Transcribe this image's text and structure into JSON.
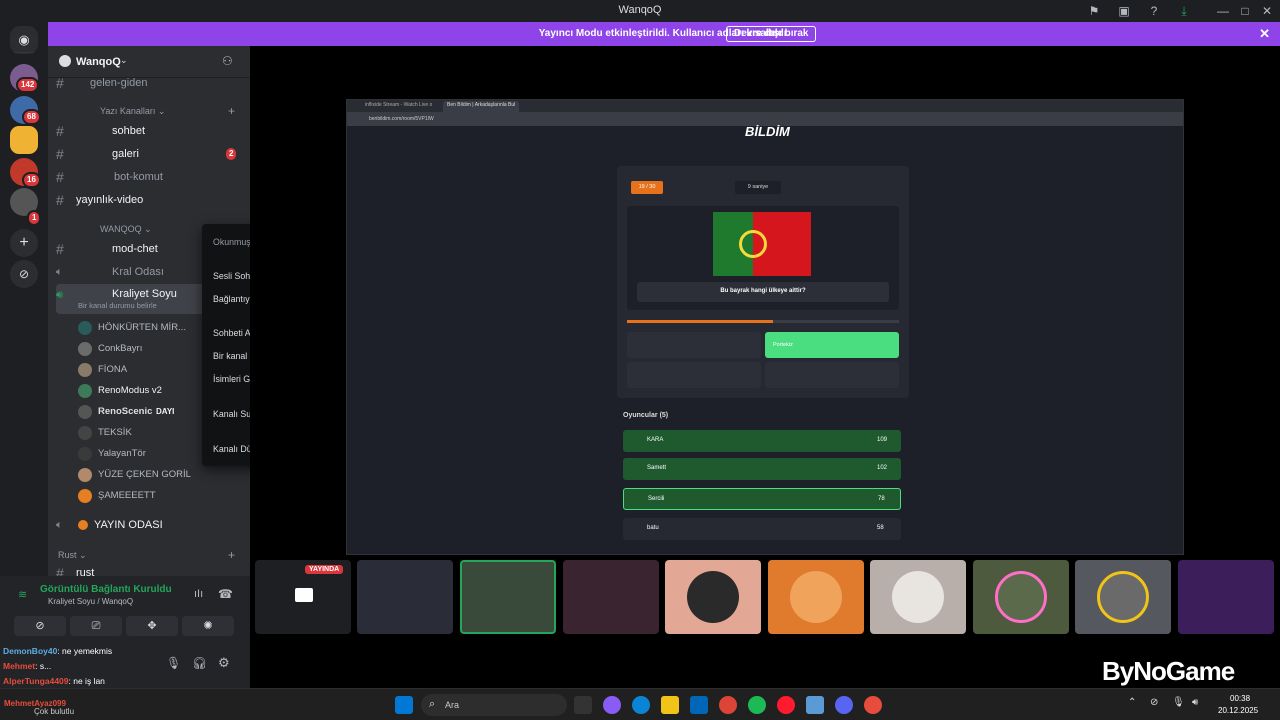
{
  "window": {
    "title": "WanqoQ"
  },
  "banner": {
    "message": "Yayıncı Modu etkinleştirildi. Kullanıcı adları kısaltıldı.",
    "button": "Devre dışı bırak"
  },
  "servers": {
    "badges": [
      "142",
      "68",
      "16",
      "1"
    ]
  },
  "guild": {
    "name": "WanqoQ"
  },
  "channels": {
    "top": [
      {
        "label": "gelen-giden"
      }
    ],
    "category1": "Yazı Kanalları",
    "text": [
      {
        "label": "sohbet"
      },
      {
        "label": "galeri",
        "badge": "2"
      },
      {
        "label": "bot-komut"
      },
      {
        "label": "yayınlık-video"
      }
    ],
    "category2": "WANQOQ",
    "wanqoq": [
      {
        "label": "mod-chet"
      },
      {
        "label": "Kral Odası"
      },
      {
        "label": "Kraliyet Soyu"
      }
    ],
    "channel_status": "Bir kanal durumu belirle",
    "members": [
      {
        "name": "HÖNKÜRTEN MİR..."
      },
      {
        "name": "ConkBayrı"
      },
      {
        "name": "FİONA"
      },
      {
        "name": "RenoModus v2"
      },
      {
        "name": "RenoScenic",
        "tag": "DAYI"
      },
      {
        "name": "TEKSİK"
      },
      {
        "name": "YalayanTör"
      },
      {
        "name": "YÜZE ÇEKEN GORİL"
      },
      {
        "name": "ŞAMEEEETT"
      }
    ],
    "yayin": "YAYIN ODASI",
    "category3": "Rust",
    "rust": "rust"
  },
  "context_menu": {
    "items": [
      "Okunmuş Olarak İşaretle",
      "Sesli Sohbete Davet et",
      "Bağlantıyı Kopyala",
      "Sohbeti Aç",
      "Bir kanal durumu belirle",
      "İsimleri Gizle",
      "Kanalı Sustur",
      "Kanalı Düzenle"
    ]
  },
  "voice": {
    "status": "Görüntülü Bağlantı Kuruldu",
    "channel": "Kraliyet Soyu / WanqoQ"
  },
  "chat": [
    {
      "user": "DemonBoy40",
      "text": ": ne yemekmis"
    },
    {
      "user": "Mehmet",
      "text": ": s..."
    },
    {
      "user": "AlperTunga4409",
      "text": ": ne iş lan"
    },
    {
      "user": "MehmetAyaz099",
      "text": ""
    }
  ],
  "user_panel": {
    "status": "Çok bulutlu"
  },
  "stream": {
    "browser_tab1": "inflixide Stream - Watch Live o",
    "browser_tab2": "Ben Bildim | Arkadaşlarınla Bul",
    "url": "benbildim.com/room/5VP1IW",
    "logo": "BİLDİM",
    "progress": "19 / 30",
    "timer": "9 saniye",
    "question": "Bu bayrak hangi ülkeye aittir?",
    "answers": [
      "Portekiz",
      "",
      "",
      ""
    ],
    "players_title": "Oyuncular (5)",
    "players": [
      {
        "name": "KARA",
        "score": "109"
      },
      {
        "name": "Samett",
        "score": "102"
      },
      {
        "name": "Sercili",
        "score": "78"
      },
      {
        "name": "batu",
        "score": "58"
      }
    ]
  },
  "tiles": {
    "live_label": "YAYINDA"
  },
  "watermark": "ByNoGame",
  "taskbar": {
    "search": "Ara",
    "time": "00:38",
    "date": "20.12.2025"
  },
  "colors": {
    "banner": "#8e44e8",
    "online": "#23a55a",
    "badge": "#da373c",
    "accent_green": "#4ade80"
  }
}
